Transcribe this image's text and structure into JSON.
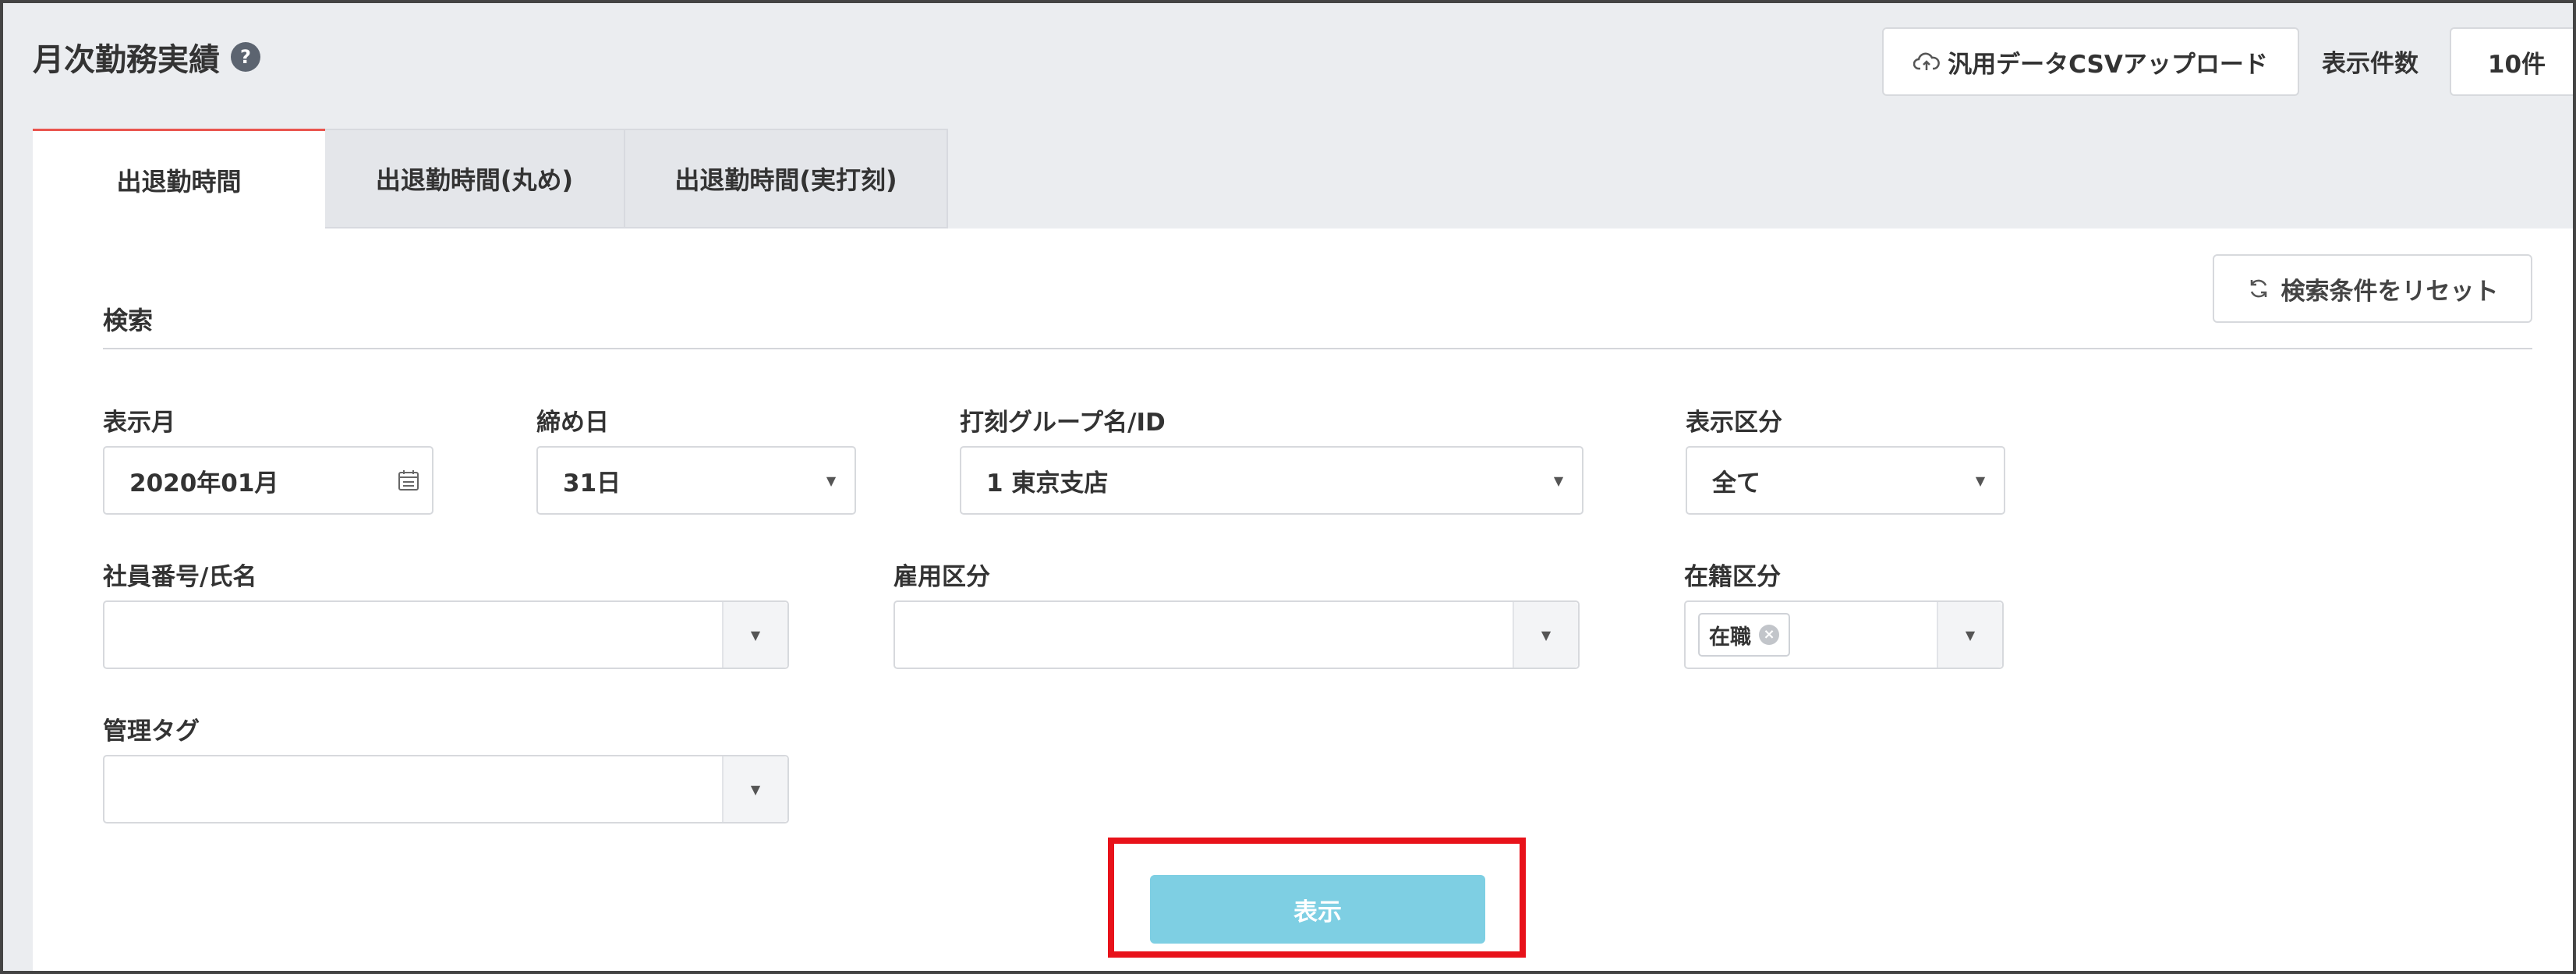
{
  "header": {
    "title": "月次勤務実績",
    "help_icon": "question-circle-icon",
    "csv_upload_label": "汎用データCSVアップロード",
    "csv_upload_icon": "cloud-upload-icon",
    "display_count_label": "表示件数",
    "display_count_value": "10件"
  },
  "tabs": [
    {
      "label": "出退勤時間",
      "active": true
    },
    {
      "label": "出退勤時間(丸め)",
      "active": false
    },
    {
      "label": "出退勤時間(実打刻)",
      "active": false
    }
  ],
  "search": {
    "title": "検索",
    "reset_label": "検索条件をリセット",
    "reset_icon": "refresh-icon",
    "fields": {
      "display_month": {
        "label": "表示月",
        "value": "2020年01月",
        "icon": "calendar-icon"
      },
      "closing_day": {
        "label": "締め日",
        "value": "31日"
      },
      "stamp_group": {
        "label": "打刻グループ名/ID",
        "value": "1 東京支店"
      },
      "display_category": {
        "label": "表示区分",
        "value": "全て"
      },
      "employee": {
        "label": "社員番号/氏名",
        "value": ""
      },
      "employment_type": {
        "label": "雇用区分",
        "value": ""
      },
      "enrollment_status": {
        "label": "在籍区分",
        "tags": [
          "在職"
        ]
      },
      "management_tag": {
        "label": "管理タグ",
        "value": ""
      }
    },
    "submit_label": "表示"
  },
  "colors": {
    "accent_tab": "#e9544e",
    "submit_button": "#7ecfe3",
    "highlight_box": "#e8121a",
    "background": "#ebedf0"
  }
}
